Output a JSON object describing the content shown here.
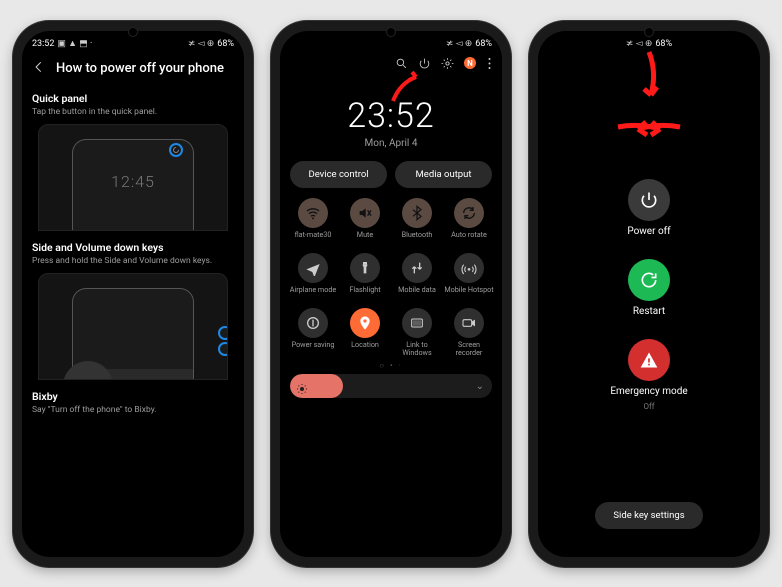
{
  "status": {
    "time": "23:52",
    "battery_pct": "68%",
    "signal_icons": "≭ ◅ ⊕",
    "left_icons": "▣ ▲ ⬒ ·"
  },
  "phone1": {
    "title": "How to power off your phone",
    "sections": {
      "quick_panel": {
        "heading": "Quick panel",
        "body": "Tap the button in the quick panel.",
        "illus_time": "12:45"
      },
      "side_volume": {
        "heading": "Side and Volume down keys",
        "body": "Press and hold the Side and Volume down keys."
      },
      "bixby": {
        "heading": "Bixby",
        "body": "Say \"Turn off the phone\" to Bixby."
      }
    }
  },
  "phone2": {
    "top_badge": "N",
    "clock": {
      "time": "23:52",
      "date": "Mon, April 4"
    },
    "pills": {
      "device_control": "Device control",
      "media_output": "Media output"
    },
    "toggles": [
      {
        "id": "flat-mate30",
        "label": "flat-mate30",
        "style": "brown",
        "icon": "wifi"
      },
      {
        "id": "mute",
        "label": "Mute",
        "style": "brown",
        "icon": "mute"
      },
      {
        "id": "bluetooth",
        "label": "Bluetooth",
        "style": "brown",
        "icon": "bluetooth"
      },
      {
        "id": "auto-rotate",
        "label": "Auto rotate",
        "style": "brown",
        "icon": "rotate"
      },
      {
        "id": "airplane",
        "label": "Airplane mode",
        "style": "dark",
        "icon": "airplane"
      },
      {
        "id": "flashlight",
        "label": "Flashlight",
        "style": "dark",
        "icon": "flashlight"
      },
      {
        "id": "mobile-data",
        "label": "Mobile data",
        "style": "dark",
        "icon": "data"
      },
      {
        "id": "hotspot",
        "label": "Mobile Hotspot",
        "style": "dark",
        "icon": "hotspot"
      },
      {
        "id": "power-saving",
        "label": "Power saving",
        "style": "dark",
        "icon": "leaf"
      },
      {
        "id": "location",
        "label": "Location",
        "style": "orange",
        "icon": "location"
      },
      {
        "id": "link-windows",
        "label": "Link to Windows",
        "style": "dark",
        "icon": "link"
      },
      {
        "id": "screen-rec",
        "label": "Screen recorder",
        "style": "dark",
        "icon": "record"
      }
    ]
  },
  "phone3": {
    "power_off": {
      "label": "Power off"
    },
    "restart": {
      "label": "Restart"
    },
    "emergency": {
      "label": "Emergency mode",
      "sub": "Off"
    },
    "side_key": "Side key settings"
  }
}
